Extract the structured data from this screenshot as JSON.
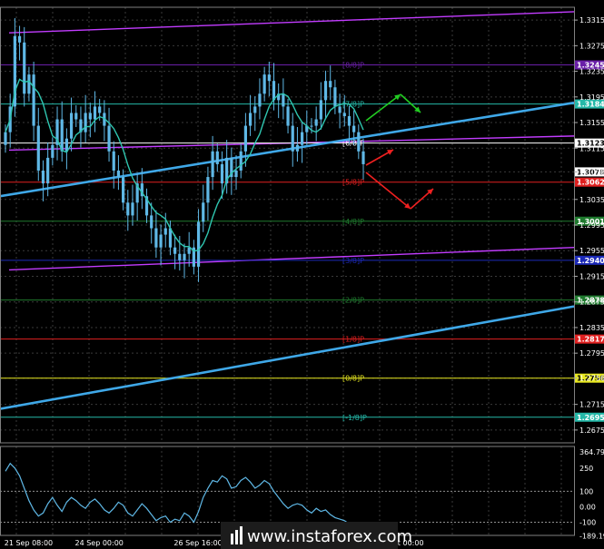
{
  "colors": {
    "background": "#000000",
    "grid": "#3a3a3a",
    "candle": "#5fb8e6",
    "ma": "#2fc6b0",
    "trend": "#3fa8e8",
    "channel": "#c23cff",
    "murrey_8": "#6a1fa8",
    "murrey_7": "#25b8a8",
    "murrey_6": "#ffffff",
    "murrey_5": "#e02020",
    "murrey_4": "#1f7a2e",
    "murrey_3": "#1c2ab8",
    "murrey_2": "#1f7a2e",
    "murrey_1": "#e02020",
    "murrey_0": "#e8e820",
    "murrey_m": "#25b8a8",
    "arrow_up": "#22cc22",
    "arrow_down": "#ee2020",
    "cci": "#5fb8e6",
    "price_tag": "#ffffff"
  },
  "chart_data": [
    {
      "type": "candlestick",
      "ylim": [
        1.2655,
        1.3335
      ],
      "y_ticks": [
        "1.3315",
        "1.3275",
        "1.3235",
        "1.3195",
        "1.3155",
        "1.3115",
        "1.3078",
        "1.3035",
        "1.2995",
        "1.2955",
        "1.2915",
        "1.2875",
        "1.2835",
        "1.2795",
        "1.2756",
        "1.2715",
        "1.2675"
      ],
      "y_tick_values": [
        1.3315,
        1.3275,
        1.3235,
        1.3195,
        1.3155,
        1.3115,
        1.3078,
        1.3035,
        1.2995,
        1.2955,
        1.2915,
        1.2875,
        1.2835,
        1.2795,
        1.2756,
        1.2715,
        1.2675
      ],
      "x_labels": [
        "21 Sep 08:00",
        "24 Sep 00:00",
        "26 Sep 16:00",
        "1 Oct 08:00",
        "4 Oct 00:00"
      ],
      "x_label_index": [
        4,
        19,
        40,
        61,
        84
      ],
      "close": [
        1.314,
        1.318,
        1.329,
        1.328,
        1.32,
        1.323,
        1.315,
        1.308,
        1.306,
        1.31,
        1.312,
        1.316,
        1.311,
        1.313,
        1.317,
        1.316,
        1.314,
        1.317,
        1.316,
        1.318,
        1.317,
        1.315,
        1.311,
        1.308,
        1.307,
        1.303,
        1.301,
        1.303,
        1.306,
        1.304,
        1.301,
        1.299,
        1.296,
        1.298,
        1.299,
        1.296,
        1.295,
        1.294,
        1.295,
        1.296,
        1.293,
        1.3,
        1.303,
        1.307,
        1.311,
        1.309,
        1.306,
        1.31,
        1.307,
        1.308,
        1.311,
        1.315,
        1.317,
        1.318,
        1.32,
        1.323,
        1.322,
        1.319,
        1.32,
        1.318,
        1.315,
        1.311,
        1.312,
        1.314,
        1.315,
        1.315,
        1.316,
        1.319,
        1.322,
        1.321,
        1.318,
        1.317,
        1.3165,
        1.315,
        1.314,
        1.311,
        1.309
      ],
      "trend_line": {
        "start": 1.304,
        "end": 1.3186
      },
      "trend_line_2": {
        "start": 1.2708,
        "end": 1.2868
      },
      "channel_top": {
        "start": 1.3295,
        "end": 1.3328
      },
      "channel_mid": {
        "start": 1.3112,
        "end": 1.3134
      },
      "channel_bottom": {
        "start": 1.2925,
        "end": 1.296
      },
      "murrey_levels": [
        {
          "label": "[8/8]P",
          "value": 1.3245,
          "tag": "1.3245",
          "color_key": "murrey_8"
        },
        {
          "label": "[7/8]P",
          "value": 1.3184,
          "tag": "1.3184",
          "color_key": "murrey_7"
        },
        {
          "label": "[6/8]P",
          "value": 1.3123,
          "tag": "1.3123",
          "color_key": "murrey_6"
        },
        {
          "label": "[5/8]P",
          "value": 1.3062,
          "tag": "1.3062",
          "color_key": "murrey_5"
        },
        {
          "label": "[4/8]P",
          "value": 1.3001,
          "tag": "1.3001",
          "color_key": "murrey_4"
        },
        {
          "label": "[3/8]P",
          "value": 1.294,
          "tag": "1.2940",
          "color_key": "murrey_3"
        },
        {
          "label": "[2/8]P",
          "value": 1.2878,
          "tag": "1.2878",
          "color_key": "murrey_2"
        },
        {
          "label": "[1/8]P",
          "value": 1.2817,
          "tag": "1.2817",
          "color_key": "murrey_1"
        },
        {
          "label": "[0/8]P",
          "value": 1.2756,
          "tag": "1.2756",
          "color_key": "murrey_0"
        },
        {
          "label": "[-1/8]P",
          "value": 1.2695,
          "tag": "1.2695",
          "color_key": "murrey_m"
        }
      ],
      "current_price": {
        "value": 1.3078,
        "tag": "1.3078"
      }
    },
    {
      "type": "line",
      "name": "CCI",
      "ylim": [
        -185,
        390
      ],
      "y_ticks": [
        "364.7924",
        "250",
        "100",
        "0.00",
        "-100",
        "-189.194"
      ],
      "y_tick_values": [
        364.7924,
        250,
        100,
        0,
        -100,
        -189.194
      ],
      "levels": [
        100,
        -100
      ],
      "values": [
        230,
        280,
        250,
        200,
        120,
        40,
        -20,
        -60,
        -40,
        20,
        60,
        10,
        -30,
        30,
        60,
        40,
        10,
        -10,
        30,
        50,
        20,
        -20,
        -40,
        -10,
        30,
        10,
        -40,
        -60,
        -20,
        20,
        -10,
        -50,
        -90,
        -70,
        -60,
        -100,
        -80,
        -90,
        -40,
        -60,
        -100,
        -30,
        60,
        120,
        170,
        160,
        200,
        180,
        120,
        130,
        170,
        190,
        160,
        120,
        140,
        170,
        150,
        100,
        60,
        20,
        -10,
        10,
        20,
        10,
        -20,
        -40,
        -10,
        -30,
        -20,
        -50,
        -70,
        -80,
        -90,
        -110,
        -130,
        -150,
        -160
      ]
    }
  ],
  "watermark": "www.instaforex.com"
}
